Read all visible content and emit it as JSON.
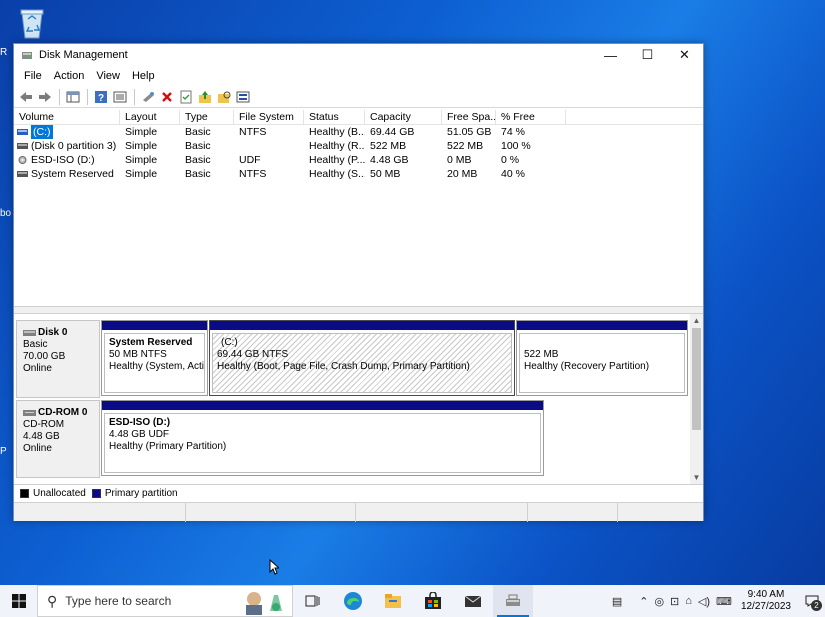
{
  "window": {
    "title": "Disk Management",
    "controls": {
      "minimize": "—",
      "maximize": "☐",
      "close": "✕"
    }
  },
  "menu": [
    "File",
    "Action",
    "View",
    "Help"
  ],
  "toolbar_icons": [
    "back-arrow-icon",
    "forward-arrow-icon",
    "console-icon",
    "help-icon",
    "list-view-icon",
    "connect-icon",
    "delete-icon",
    "properties-icon",
    "folder-up-icon",
    "folder-search-icon",
    "disk-view-icon"
  ],
  "columns": [
    "Volume",
    "Layout",
    "Type",
    "File System",
    "Status",
    "Capacity",
    "Free Spa...",
    "% Free"
  ],
  "volumes": [
    {
      "volume": "(C:)",
      "layout": "Simple",
      "type": "Basic",
      "fs": "NTFS",
      "status": "Healthy (B...",
      "capacity": "69.44 GB",
      "free": "51.05 GB",
      "pct": "74 %",
      "selected": true
    },
    {
      "volume": "(Disk 0 partition 3)",
      "layout": "Simple",
      "type": "Basic",
      "fs": "",
      "status": "Healthy (R...",
      "capacity": "522 MB",
      "free": "522 MB",
      "pct": "100 %",
      "selected": false
    },
    {
      "volume": "ESD-ISO (D:)",
      "layout": "Simple",
      "type": "Basic",
      "fs": "UDF",
      "status": "Healthy (P...",
      "capacity": "4.48 GB",
      "free": "0 MB",
      "pct": "0 %",
      "selected": false
    },
    {
      "volume": "System Reserved",
      "layout": "Simple",
      "type": "Basic",
      "fs": "NTFS",
      "status": "Healthy (S...",
      "capacity": "50 MB",
      "free": "20 MB",
      "pct": "40 %",
      "selected": false
    }
  ],
  "disks": {
    "disk0": {
      "name": "Disk 0",
      "type": "Basic",
      "size": "70.00 GB",
      "state": "Online",
      "partitions": [
        {
          "name": "System Reserved",
          "size": "50 MB NTFS",
          "status": "Healthy (System, Activ"
        },
        {
          "name": "(C:)",
          "size": "69.44 GB NTFS",
          "status": "Healthy (Boot, Page File, Crash Dump, Primary Partition)"
        },
        {
          "name": "",
          "size": "522 MB",
          "status": "Healthy (Recovery Partition)"
        }
      ]
    },
    "cdrom0": {
      "name": "CD-ROM 0",
      "type": "CD-ROM",
      "size": "4.48 GB",
      "state": "Online",
      "partitions": [
        {
          "name": "ESD-ISO  (D:)",
          "size": "4.48 GB UDF",
          "status": "Healthy (Primary Partition)"
        }
      ]
    }
  },
  "legend": {
    "unallocated": "Unallocated",
    "primary": "Primary partition",
    "unallocated_color": "#000000",
    "primary_color": "#0b0b86"
  },
  "taskbar": {
    "search_placeholder": "Type here to search",
    "apps": [
      "task-view-icon",
      "edge-icon",
      "file-explorer-icon",
      "store-icon",
      "mail-icon",
      "disk-management-icon"
    ],
    "time": "9:40 AM",
    "date": "12/27/2023",
    "notification_count": "2"
  },
  "desktop": {
    "edge_letters": [
      "R",
      "bo",
      "P"
    ]
  }
}
